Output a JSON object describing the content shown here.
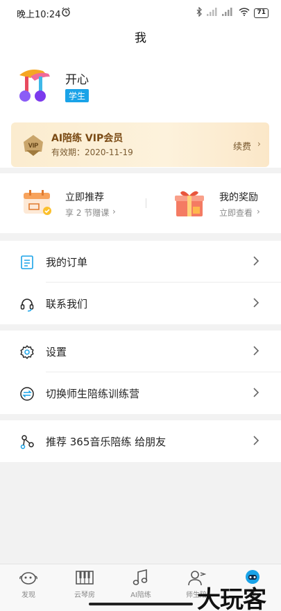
{
  "status_bar": {
    "time": "晚上10:24",
    "battery": "71"
  },
  "header": {
    "title": "我"
  },
  "profile": {
    "name": "开心",
    "role_tag": "学生"
  },
  "vip": {
    "title": "AI陪练 VIP会员",
    "expiry": "有效期：2020-11-19",
    "renew": "续费",
    "badge": "VIP"
  },
  "promos": [
    {
      "title": "立即推荐",
      "sub": "享 2 节赠课"
    },
    {
      "title": "我的奖励",
      "sub": "立即查看"
    }
  ],
  "menu": {
    "orders": "我的订单",
    "contact": "联系我们",
    "settings": "设置",
    "switch_camp": "切换师生陪练训练营",
    "share": "推荐 365音乐陪练 给朋友"
  },
  "tabs": [
    {
      "label": "发现",
      "icon": "discover-icon"
    },
    {
      "label": "云琴房",
      "icon": "piano-icon"
    },
    {
      "label": "AI陪练",
      "icon": "music-note-icon"
    },
    {
      "label": "师生陪",
      "icon": "teacher-icon"
    },
    {
      "label": "我",
      "icon": "robot-icon"
    }
  ],
  "watermark": "大玩客",
  "colors": {
    "accent": "#1aa3e8",
    "vip_text": "#7a4a14",
    "background": "#f2f2f2"
  }
}
